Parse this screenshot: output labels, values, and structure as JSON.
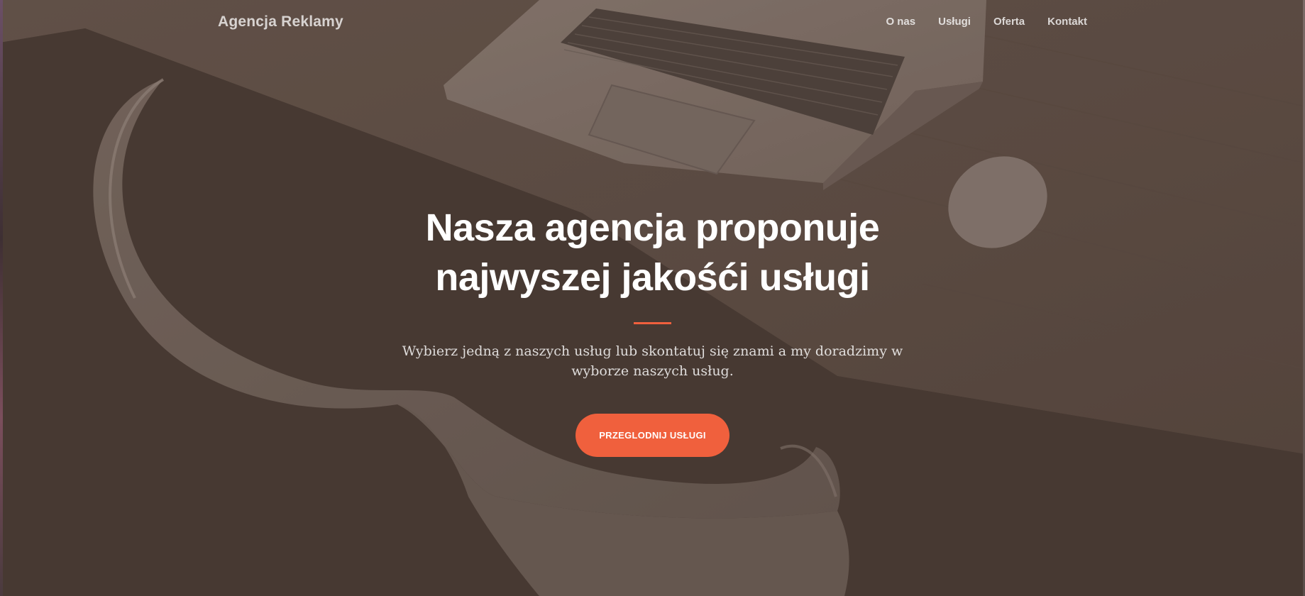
{
  "nav": {
    "brand": "Agencja Reklamy",
    "links": [
      "O nas",
      "Usługi",
      "Oferta",
      "Kontakt"
    ]
  },
  "hero": {
    "title_line1": "Nasza agencja proponuje",
    "title_line2": "najwyszej jakośći usługi",
    "subtitle": "Wybierz jedną z naszych usług lub skontatuj się znami a my doradzimy w wyborze naszych usług.",
    "cta_label": "PRZEGLODNIJ USŁUGI"
  },
  "colors": {
    "accent": "#f0603d",
    "overlay": "#4a3d35"
  }
}
